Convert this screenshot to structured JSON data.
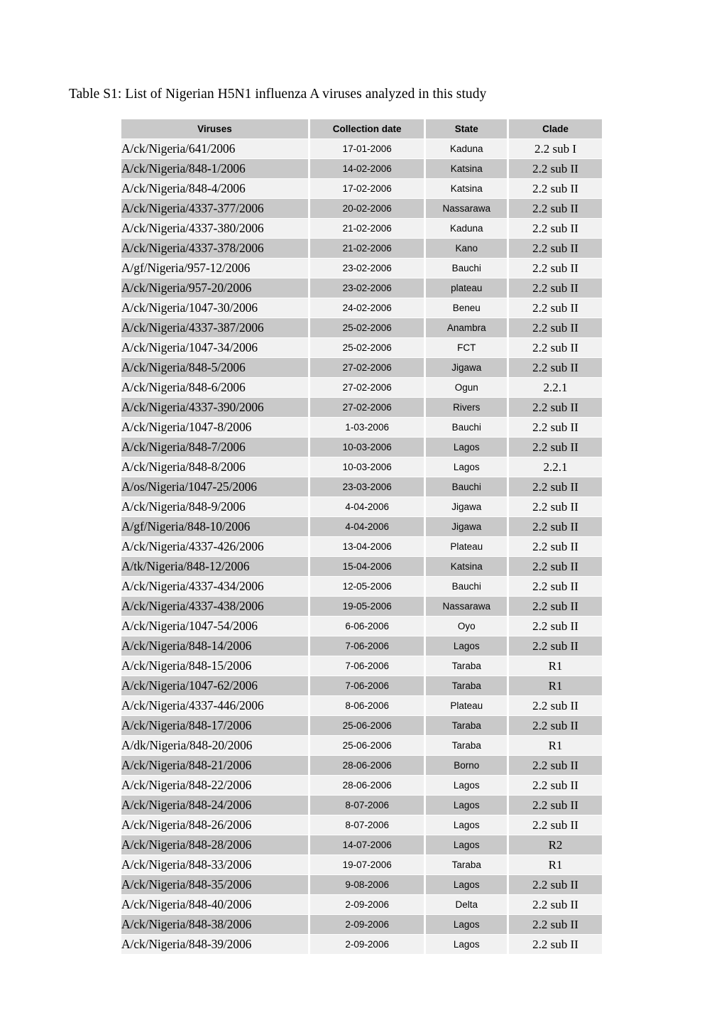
{
  "document": {
    "title": "Table S1: List of Nigerian H5N1 influenza A viruses analyzed in this study"
  },
  "table": {
    "columns": [
      {
        "key": "virus",
        "label": "Viruses"
      },
      {
        "key": "date",
        "label": "Collection date"
      },
      {
        "key": "state",
        "label": "State"
      },
      {
        "key": "clade",
        "label": "Clade"
      }
    ],
    "colors": {
      "header_bg": "#c9c9c9",
      "row_dark_bg": "#c9c9c9",
      "row_light_bg": "#f1f1f1",
      "text": "#000000",
      "page_bg": "#ffffff"
    },
    "row_count": 41,
    "rows": [
      {
        "virus": "A/ck/Nigeria/641/2006",
        "date": "17-01-2006",
        "state": "Kaduna",
        "clade": "2.2 sub I"
      },
      {
        "virus": "A/ck/Nigeria/848-1/2006",
        "date": "14-02-2006",
        "state": "Katsina",
        "clade": "2.2 sub II"
      },
      {
        "virus": "A/ck/Nigeria/848-4/2006",
        "date": "17-02-2006",
        "state": "Katsina",
        "clade": "2.2 sub II"
      },
      {
        "virus": "A/ck/Nigeria/4337-377/2006",
        "date": "20-02-2006",
        "state": "Nassarawa",
        "clade": "2.2 sub II"
      },
      {
        "virus": "A/ck/Nigeria/4337-380/2006",
        "date": "21-02-2006",
        "state": "Kaduna",
        "clade": "2.2 sub II"
      },
      {
        "virus": "A/ck/Nigeria/4337-378/2006",
        "date": "21-02-2006",
        "state": "Kano",
        "clade": "2.2 sub II"
      },
      {
        "virus": "A/gf/Nigeria/957-12/2006",
        "date": "23-02-2006",
        "state": "Bauchi",
        "clade": "2.2 sub II"
      },
      {
        "virus": "A/ck/Nigeria/957-20/2006",
        "date": "23-02-2006",
        "state": "plateau",
        "clade": "2.2 sub II"
      },
      {
        "virus": "A/ck/Nigeria/1047-30/2006",
        "date": "24-02-2006",
        "state": "Beneu",
        "clade": "2.2 sub II"
      },
      {
        "virus": "A/ck/Nigeria/4337-387/2006",
        "date": "25-02-2006",
        "state": "Anambra",
        "clade": "2.2 sub II"
      },
      {
        "virus": "A/ck/Nigeria/1047-34/2006",
        "date": "25-02-2006",
        "state": "FCT",
        "clade": "2.2 sub II"
      },
      {
        "virus": "A/ck/Nigeria/848-5/2006",
        "date": "27-02-2006",
        "state": "Jigawa",
        "clade": "2.2 sub II"
      },
      {
        "virus": "A/ck/Nigeria/848-6/2006",
        "date": "27-02-2006",
        "state": "Ogun",
        "clade": "2.2.1"
      },
      {
        "virus": "A/ck/Nigeria/4337-390/2006",
        "date": "27-02-2006",
        "state": "Rivers",
        "clade": "2.2 sub II"
      },
      {
        "virus": "A/ck/Nigeria/1047-8/2006",
        "date": "1-03-2006",
        "state": "Bauchi",
        "clade": "2.2 sub II"
      },
      {
        "virus": "A/ck/Nigeria/848-7/2006",
        "date": "10-03-2006",
        "state": "Lagos",
        "clade": "2.2 sub II"
      },
      {
        "virus": "A/ck/Nigeria/848-8/2006",
        "date": "10-03-2006",
        "state": "Lagos",
        "clade": "2.2.1"
      },
      {
        "virus": "A/os/Nigeria/1047-25/2006",
        "date": "23-03-2006",
        "state": "Bauchi",
        "clade": "2.2 sub II"
      },
      {
        "virus": "A/ck/Nigeria/848-9/2006",
        "date": "4-04-2006",
        "state": "Jigawa",
        "clade": "2.2 sub II"
      },
      {
        "virus": "A/gf/Nigeria/848-10/2006",
        "date": "4-04-2006",
        "state": "Jigawa",
        "clade": "2.2 sub II"
      },
      {
        "virus": "A/ck/Nigeria/4337-426/2006",
        "date": "13-04-2006",
        "state": "Plateau",
        "clade": "2.2 sub II"
      },
      {
        "virus": "A/tk/Nigeria/848-12/2006",
        "date": "15-04-2006",
        "state": "Katsina",
        "clade": "2.2 sub II"
      },
      {
        "virus": "A/ck/Nigeria/4337-434/2006",
        "date": "12-05-2006",
        "state": "Bauchi",
        "clade": "2.2 sub II"
      },
      {
        "virus": "A/ck/Nigeria/4337-438/2006",
        "date": "19-05-2006",
        "state": "Nassarawa",
        "clade": "2.2 sub II"
      },
      {
        "virus": "A/ck/Nigeria/1047-54/2006",
        "date": "6-06-2006",
        "state": "Oyo",
        "clade": "2.2 sub II"
      },
      {
        "virus": "A/ck/Nigeria/848-14/2006",
        "date": "7-06-2006",
        "state": "Lagos",
        "clade": "2.2 sub II"
      },
      {
        "virus": "A/ck/Nigeria/848-15/2006",
        "date": "7-06-2006",
        "state": "Taraba",
        "clade": "R1"
      },
      {
        "virus": "A/ck/Nigeria/1047-62/2006",
        "date": "7-06-2006",
        "state": "Taraba",
        "clade": "R1"
      },
      {
        "virus": "A/ck/Nigeria/4337-446/2006",
        "date": "8-06-2006",
        "state": "Plateau",
        "clade": "2.2 sub II"
      },
      {
        "virus": "A/ck/Nigeria/848-17/2006",
        "date": "25-06-2006",
        "state": "Taraba",
        "clade": "2.2 sub II"
      },
      {
        "virus": "A/dk/Nigeria/848-20/2006",
        "date": "25-06-2006",
        "state": "Taraba",
        "clade": "R1"
      },
      {
        "virus": "A/ck/Nigeria/848-21/2006",
        "date": "28-06-2006",
        "state": "Borno",
        "clade": "2.2 sub II"
      },
      {
        "virus": "A/ck/Nigeria/848-22/2006",
        "date": "28-06-2006",
        "state": "Lagos",
        "clade": "2.2 sub II"
      },
      {
        "virus": "A/ck/Nigeria/848-24/2006",
        "date": "8-07-2006",
        "state": "Lagos",
        "clade": "2.2 sub II"
      },
      {
        "virus": "A/ck/Nigeria/848-26/2006",
        "date": "8-07-2006",
        "state": "Lagos",
        "clade": "2.2 sub II"
      },
      {
        "virus": "A/ck/Nigeria/848-28/2006",
        "date": "14-07-2006",
        "state": "Lagos",
        "clade": "R2"
      },
      {
        "virus": "A/ck/Nigeria/848-33/2006",
        "date": "19-07-2006",
        "state": "Taraba",
        "clade": "R1"
      },
      {
        "virus": "A/ck/Nigeria/848-35/2006",
        "date": "9-08-2006",
        "state": "Lagos",
        "clade": "2.2 sub II"
      },
      {
        "virus": "A/ck/Nigeria/848-40/2006",
        "date": "2-09-2006",
        "state": "Delta",
        "clade": "2.2 sub II"
      },
      {
        "virus": "A/ck/Nigeria/848-38/2006",
        "date": "2-09-2006",
        "state": "Lagos",
        "clade": "2.2 sub II"
      },
      {
        "virus": "A/ck/Nigeria/848-39/2006",
        "date": "2-09-2006",
        "state": "Lagos",
        "clade": "2.2 sub II"
      }
    ]
  }
}
